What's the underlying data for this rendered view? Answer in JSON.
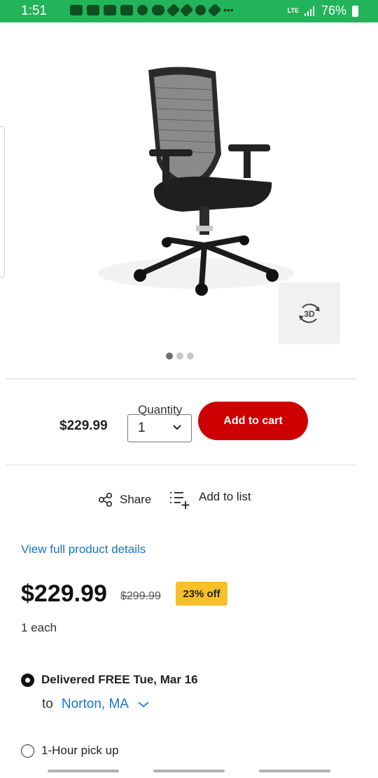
{
  "status_bar": {
    "time": "1:51",
    "network": "LTE",
    "battery": "76%"
  },
  "gallery": {
    "button_3d_label": "3D",
    "slides": 3,
    "active_slide": 1
  },
  "buy_bar": {
    "price": "$229.99",
    "quantity_label": "Quantity",
    "quantity_value": "1",
    "add_to_cart": "Add to cart"
  },
  "actions": {
    "share": "Share",
    "add_to_list": "Add to list"
  },
  "details_link": "View full product details",
  "pricing": {
    "price": "$229.99",
    "original_price": "$299.99",
    "discount": "23% off",
    "unit": "1 each"
  },
  "fulfillment": {
    "delivery": "Delivered FREE Tue, Mar 16",
    "to_word": "to",
    "location": "Norton, MA",
    "pickup": "1-Hour pick up"
  },
  "colors": {
    "status_bar": "#22b45a",
    "accent_red": "#cc0000",
    "link_blue": "#1874cd",
    "badge_yellow": "#f7c02a"
  }
}
